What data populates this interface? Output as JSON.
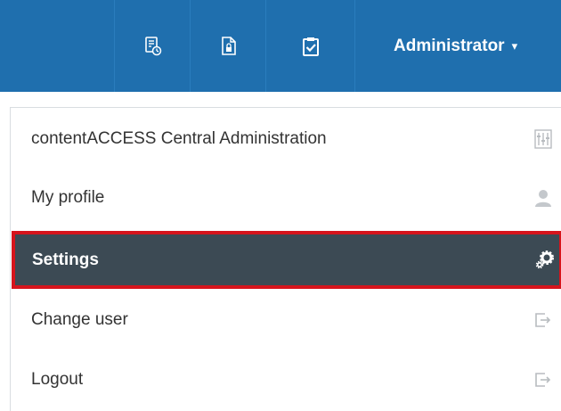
{
  "header": {
    "user_label": "Administrator",
    "caret": "▾",
    "icons": [
      "task-list-clock-icon",
      "locked-document-icon",
      "clipboard-check-icon"
    ]
  },
  "menu": {
    "items": [
      {
        "label": "contentACCESS Central Administration",
        "icon": "sliders-icon"
      },
      {
        "label": "My profile",
        "icon": "user-icon"
      },
      {
        "label": "Settings",
        "icon": "gears-icon",
        "selected": true
      },
      {
        "label": "Change user",
        "icon": "sign-out-icon"
      },
      {
        "label": "Logout",
        "icon": "sign-out-icon"
      }
    ]
  },
  "colors": {
    "topbar": "#1f6fae",
    "selected_bg": "#3c4a54",
    "highlight_border": "#d6141c"
  }
}
